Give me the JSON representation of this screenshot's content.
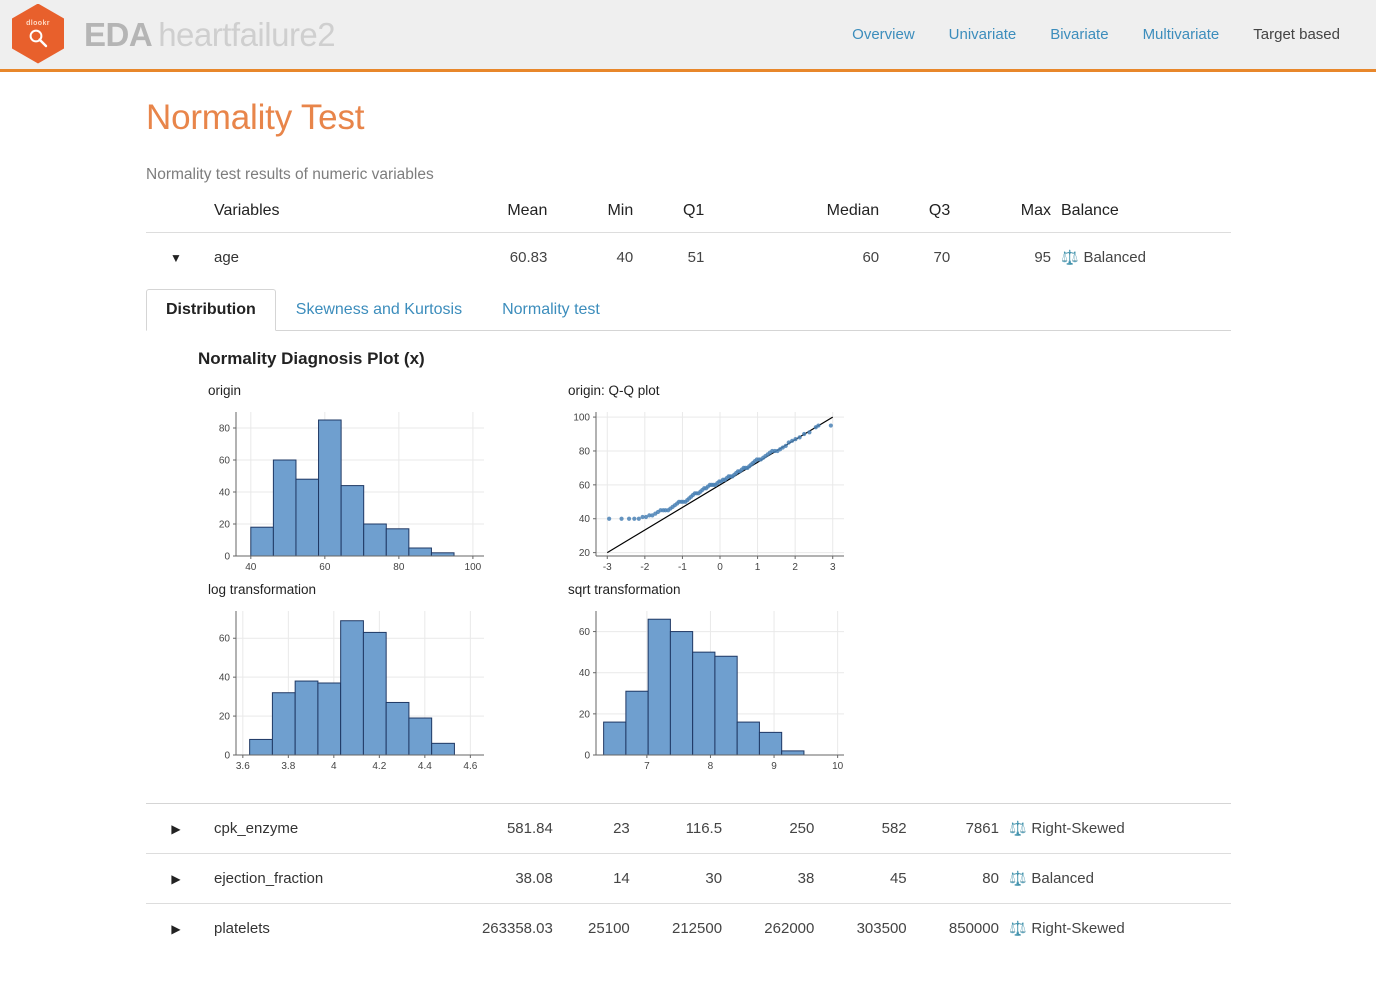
{
  "header": {
    "logo_label": "dlookr",
    "brand_primary": "EDA",
    "brand_dataset": "heartfailure2",
    "nav": [
      {
        "label": "Overview",
        "active": false
      },
      {
        "label": "Univariate",
        "active": false
      },
      {
        "label": "Bivariate",
        "active": false
      },
      {
        "label": "Multivariate",
        "active": false
      },
      {
        "label": "Target based",
        "active": true
      }
    ],
    "accent_color": "#e8872b",
    "link_color": "#3c8dbc"
  },
  "page": {
    "title": "Normality Test",
    "subtitle": "Normality test results of numeric variables",
    "title_color": "#e8854a"
  },
  "table": {
    "headers": [
      "Variables",
      "Mean",
      "Min",
      "Q1",
      "Median",
      "Q3",
      "Max",
      "Balance"
    ],
    "expanded_icon": "▼",
    "collapsed_icon": "▶",
    "balance_icon": "⚖️",
    "rows": [
      {
        "toggle": "▼",
        "variable": "age",
        "mean": "60.83",
        "min": "40",
        "q1": "51",
        "median": "60",
        "q3": "70",
        "max": "95",
        "balance": "Balanced",
        "expanded": true
      },
      {
        "toggle": "▶",
        "variable": "cpk_enzyme",
        "mean": "581.84",
        "min": "23",
        "q1": "116.5",
        "median": "250",
        "q3": "582",
        "max": "7861",
        "balance": "Right-Skewed",
        "expanded": false
      },
      {
        "toggle": "▶",
        "variable": "ejection_fraction",
        "mean": "38.08",
        "min": "14",
        "q1": "30",
        "median": "38",
        "q3": "45",
        "max": "80",
        "balance": "Balanced",
        "expanded": false
      },
      {
        "toggle": "▶",
        "variable": "platelets",
        "mean": "263358.03",
        "min": "25100",
        "q1": "212500",
        "median": "262000",
        "q3": "303500",
        "max": "850000",
        "balance": "Right-Skewed",
        "expanded": false
      }
    ]
  },
  "detail": {
    "tabs": [
      {
        "label": "Distribution",
        "active": true
      },
      {
        "label": "Skewness and Kurtosis",
        "active": false
      },
      {
        "label": "Normality test",
        "active": false
      }
    ],
    "plot_title": "Normality Diagnosis Plot (x)"
  },
  "chart_data": [
    {
      "type": "bar",
      "title": "origin",
      "xlabel": "",
      "ylabel": "",
      "bin_edges": [
        40,
        46.1,
        52.2,
        58.3,
        64.4,
        70.5,
        76.6,
        82.7,
        88.8,
        94.9,
        101
      ],
      "values": [
        18,
        60,
        48,
        85,
        44,
        20,
        17,
        5,
        2
      ],
      "xticks": [
        40,
        60,
        80,
        100
      ],
      "yticks": [
        0,
        20,
        40,
        60,
        80
      ],
      "xlim": [
        36,
        103
      ],
      "ylim": [
        0,
        90
      ],
      "grid": true,
      "bar_fill": "#6f9fcf",
      "bar_stroke": "#1f3864"
    },
    {
      "type": "scatter",
      "title": "origin: Q-Q plot",
      "xlabel": "",
      "ylabel": "",
      "xticks": [
        -3,
        -2,
        -1,
        0,
        1,
        2,
        3
      ],
      "yticks": [
        20,
        40,
        60,
        80,
        100
      ],
      "xlim": [
        -3.3,
        3.3
      ],
      "ylim": [
        18,
        103
      ],
      "grid": true,
      "reference_line": {
        "x0": -3,
        "y0": 20,
        "x1": 3,
        "y1": 100,
        "color": "#000000"
      },
      "point_color": "#4a81b5",
      "points": [
        [
          -2.95,
          40
        ],
        [
          -2.62,
          40
        ],
        [
          -2.42,
          40
        ],
        [
          -2.28,
          40
        ],
        [
          -2.16,
          40
        ],
        [
          -2.06,
          41
        ],
        [
          -1.97,
          41
        ],
        [
          -1.88,
          42
        ],
        [
          -1.8,
          42
        ],
        [
          -1.72,
          43
        ],
        [
          -1.65,
          44
        ],
        [
          -1.58,
          45
        ],
        [
          -1.51,
          45
        ],
        [
          -1.45,
          45
        ],
        [
          -1.38,
          45
        ],
        [
          -1.32,
          46
        ],
        [
          -1.26,
          47
        ],
        [
          -1.2,
          48
        ],
        [
          -1.14,
          49
        ],
        [
          -1.09,
          50
        ],
        [
          -1.03,
          50
        ],
        [
          -0.98,
          50
        ],
        [
          -0.92,
          50
        ],
        [
          -0.87,
          51
        ],
        [
          -0.82,
          52
        ],
        [
          -0.77,
          53
        ],
        [
          -0.72,
          54
        ],
        [
          -0.67,
          55
        ],
        [
          -0.62,
          55
        ],
        [
          -0.57,
          55
        ],
        [
          -0.52,
          56
        ],
        [
          -0.47,
          57
        ],
        [
          -0.42,
          58
        ],
        [
          -0.37,
          58
        ],
        [
          -0.32,
          59
        ],
        [
          -0.27,
          60
        ],
        [
          -0.22,
          60
        ],
        [
          -0.17,
          60
        ],
        [
          -0.12,
          60
        ],
        [
          -0.07,
          61
        ],
        [
          -0.02,
          62
        ],
        [
          0.03,
          62
        ],
        [
          0.08,
          63
        ],
        [
          0.13,
          63
        ],
        [
          0.18,
          64
        ],
        [
          0.23,
          65
        ],
        [
          0.28,
          65
        ],
        [
          0.33,
          65
        ],
        [
          0.38,
          66
        ],
        [
          0.43,
          67
        ],
        [
          0.48,
          68
        ],
        [
          0.53,
          68
        ],
        [
          0.58,
          69
        ],
        [
          0.63,
          70
        ],
        [
          0.68,
          70
        ],
        [
          0.73,
          70
        ],
        [
          0.78,
          71
        ],
        [
          0.83,
          72
        ],
        [
          0.88,
          73
        ],
        [
          0.93,
          74
        ],
        [
          0.98,
          75
        ],
        [
          1.04,
          75
        ],
        [
          1.09,
          75
        ],
        [
          1.15,
          76
        ],
        [
          1.21,
          77
        ],
        [
          1.27,
          78
        ],
        [
          1.33,
          79
        ],
        [
          1.39,
          80
        ],
        [
          1.46,
          80
        ],
        [
          1.53,
          80
        ],
        [
          1.6,
          81
        ],
        [
          1.67,
          82
        ],
        [
          1.75,
          83
        ],
        [
          1.83,
          85
        ],
        [
          1.92,
          86
        ],
        [
          2.01,
          87
        ],
        [
          2.12,
          88
        ],
        [
          2.24,
          90
        ],
        [
          2.38,
          91
        ],
        [
          2.55,
          94
        ],
        [
          2.62,
          95
        ],
        [
          2.95,
          95
        ]
      ]
    },
    {
      "type": "bar",
      "title": "log transformation",
      "xlabel": "",
      "ylabel": "",
      "bin_edges": [
        3.63,
        3.73,
        3.83,
        3.93,
        4.03,
        4.13,
        4.23,
        4.33,
        4.43,
        4.53,
        4.62
      ],
      "values": [
        8,
        32,
        38,
        37,
        69,
        63,
        27,
        19,
        6
      ],
      "xticks": [
        3.6,
        3.8,
        4.0,
        4.2,
        4.4,
        4.6
      ],
      "yticks": [
        0,
        20,
        40,
        60
      ],
      "xlim": [
        3.57,
        4.66
      ],
      "ylim": [
        0,
        74
      ],
      "grid": true,
      "bar_fill": "#6f9fcf",
      "bar_stroke": "#1f3864"
    },
    {
      "type": "bar",
      "title": "sqrt transformation",
      "xlabel": "",
      "ylabel": "",
      "bin_edges": [
        6.32,
        6.67,
        7.02,
        7.37,
        7.72,
        8.07,
        8.42,
        8.77,
        9.12,
        9.47,
        9.82
      ],
      "values": [
        16,
        31,
        66,
        60,
        50,
        48,
        16,
        11,
        2
      ],
      "xticks": [
        7,
        8,
        9,
        10
      ],
      "yticks": [
        0,
        20,
        40,
        60
      ],
      "xlim": [
        6.2,
        10.1
      ],
      "ylim": [
        0,
        70
      ],
      "grid": true,
      "bar_fill": "#6f9fcf",
      "bar_stroke": "#1f3864"
    }
  ]
}
